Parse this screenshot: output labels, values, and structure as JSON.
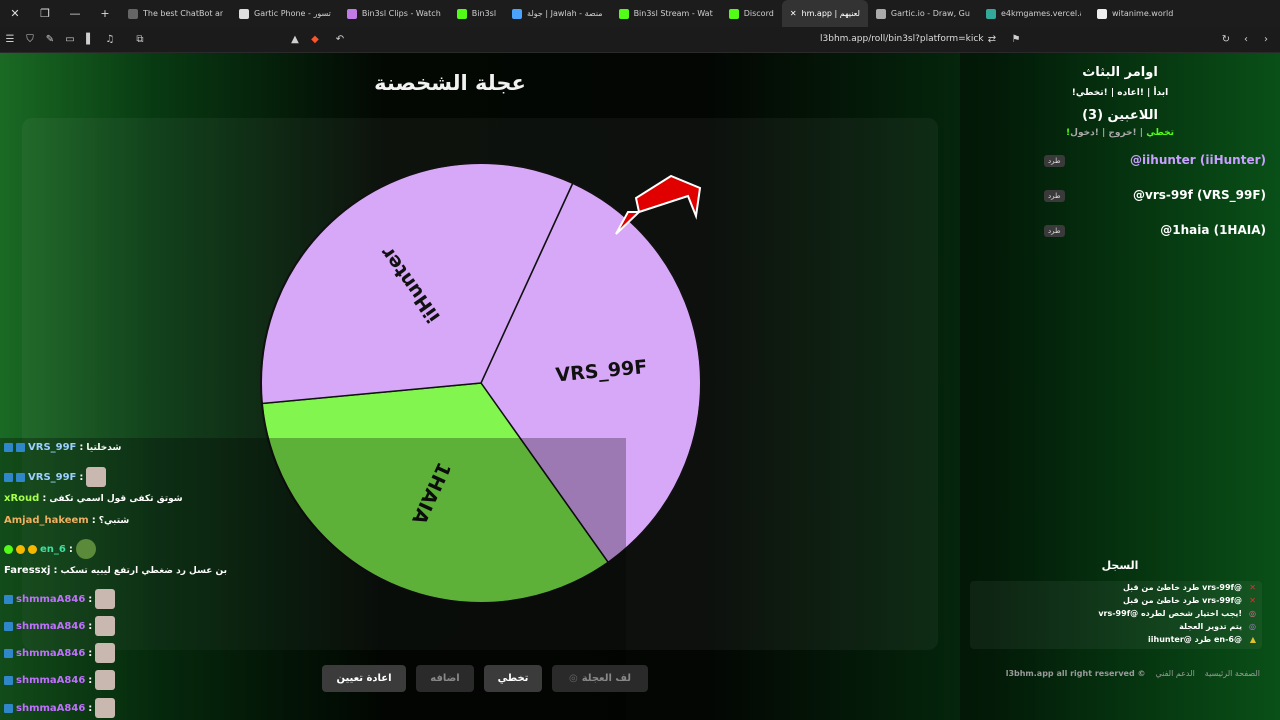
{
  "tabs": [
    {
      "label": "The best ChatBot an",
      "fav": "#666"
    },
    {
      "label": "Gartic Phone - تسور",
      "fav": "#ddd"
    },
    {
      "label": "Bin3sl Clips - Watch",
      "fav": "#c07be8"
    },
    {
      "label": "Bin3sl",
      "fav": "#53fc18"
    },
    {
      "label": "جولة | Jawlah - منصة",
      "fav": "#4aa3ff"
    },
    {
      "label": "Bin3sl Stream - Wat",
      "fav": "#53fc18"
    },
    {
      "label": "Discord",
      "fav": "#53fc18"
    },
    {
      "label": "hm.app | لعنيهم",
      "fav": "#5865f2",
      "active": true
    },
    {
      "label": "Gartic.io - Draw, Gu",
      "fav": "#aaa"
    },
    {
      "label": "e4kmgames.vercel.a",
      "fav": "#3a9"
    },
    {
      "label": "witanime.world",
      "fav": "#eee"
    }
  ],
  "url": "l3bhm.app/roll/bin3sl?platform=kick",
  "page": {
    "title": "عجلة الشخصنة"
  },
  "wheel": {
    "slices": [
      {
        "name": "VRS_99F",
        "color": "#d8a8f8",
        "share": 0.3333
      },
      {
        "name": "1HAIA",
        "color": "#82f54f",
        "share": 0.3333
      },
      {
        "name": "iiHunter",
        "color": "#d8a8f8",
        "share": 0.3333
      }
    ]
  },
  "sidebar": {
    "commands_title": "اوامر البثاث",
    "commands": "!ابدأ | !اعاده | !تخطي",
    "players_title": "اللاعبين (3)",
    "join": "!دخول",
    "leave": "!خروج",
    "skip": "!تخطي",
    "kick_label": "طرد",
    "players": [
      "@iihunter (iiHunter)",
      "@vrs-99f (VRS_99F)",
      "@1haia (1HAIA)"
    ],
    "log_title": "السجل",
    "log": [
      {
        "text": "طرد خاطئ من قبل vrs-99f@",
        "color": "#fff",
        "icon": "✕",
        "icon_color": "#e03030"
      },
      {
        "text": "طرد خاطئ من قبل vrs-99f@",
        "color": "#fff",
        "icon": "✕",
        "icon_color": "#e03030"
      },
      {
        "text": "vrs-99f@ يجب اختيار شخص لطرده!",
        "color": "#fff",
        "icon": "◎",
        "icon_color": "#f06aa0"
      },
      {
        "text": "يتم تدوير العجلة",
        "color": "#fff",
        "icon": "◎",
        "icon_color": "#b57be0"
      },
      {
        "text": "iihunter@ طرد en-6@",
        "color": "#fff",
        "icon": "▲",
        "icon_color": "#e0c030"
      }
    ],
    "footer": [
      "الصفحة الرئيسية",
      "الدعم الفني",
      "l3bhm.app all right reserved ©"
    ]
  },
  "buttons": {
    "spin": "لف العجلة",
    "skip": "تخطي",
    "add": "اضافه",
    "reset": "اعادة تعيين"
  },
  "chat": [
    {
      "user": "VRS_99F",
      "color": "#9bd0ff",
      "msg": "شدخلتيا",
      "badges": 2,
      "avatar": false
    },
    {
      "user": "VRS_99F",
      "color": "#9bd0ff",
      "msg": "",
      "badges": 2,
      "avatar": true
    },
    {
      "user": "xRoud",
      "color": "#a6ff4a",
      "msg": "شوتق تكفى قول اسمي تكفى",
      "badges": 0,
      "avatar": false
    },
    {
      "user": "Amjad_hakeem",
      "color": "#f0b060",
      "msg": "شتبي؟",
      "badges": 0,
      "avatar": false
    },
    {
      "user": "en_6",
      "color": "#3fe0a0",
      "msg": "",
      "badges": 3,
      "avatar": true
    },
    {
      "user": "Faressxj",
      "color": "#ffffff",
      "msg": "بن عسل رد ضغطي ارتفع ليبيه تسكب",
      "badges": 0,
      "avatar": false
    },
    {
      "user": "shmmaA846",
      "color": "#c070ff",
      "msg": "",
      "badges": 1,
      "avatar": true
    },
    {
      "user": "shmmaA846",
      "color": "#c070ff",
      "msg": "",
      "badges": 1,
      "avatar": true
    },
    {
      "user": "shmmaA846",
      "color": "#c070ff",
      "msg": "",
      "badges": 1,
      "avatar": true
    },
    {
      "user": "shmmaA846",
      "color": "#c070ff",
      "msg": "",
      "badges": 1,
      "avatar": true
    },
    {
      "user": "shmmaA846",
      "color": "#c070ff",
      "msg": "",
      "badges": 1,
      "avatar": true
    }
  ]
}
